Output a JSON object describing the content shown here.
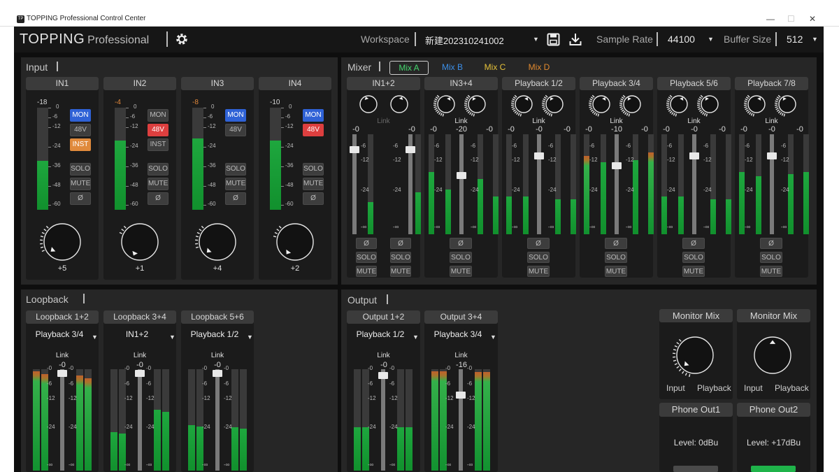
{
  "window": {
    "title": "TOPPING Professional Control Center",
    "icon": "topping-app-icon",
    "minimize": "—",
    "maximize": "☐",
    "close": "✕"
  },
  "topbar": {
    "brand": "TOPPING",
    "brand_sub": "Professional",
    "workspace_label": "Workspace",
    "workspace_value": "新建202310241002",
    "sample_rate_label": "Sample Rate",
    "sample_rate_value": "44100",
    "buffer_size_label": "Buffer Size",
    "buffer_size_value": "512"
  },
  "input": {
    "label": "Input",
    "channels": [
      {
        "name": "IN1",
        "peak": "-18",
        "knob": "+5",
        "mon": "MON",
        "v48": "48V",
        "inst": "INST",
        "solo": "SOLO",
        "mute": "MUTE",
        "phase": "Ø",
        "level": 0.48
      },
      {
        "name": "IN2",
        "peak": "-4",
        "knob": "+1",
        "mon": "MON",
        "v48": "48V",
        "inst": "INST",
        "solo": "SOLO",
        "mute": "MUTE",
        "phase": "Ø",
        "level": 0.68
      },
      {
        "name": "IN3",
        "peak": "-8",
        "knob": "+4",
        "mon": "MON",
        "v48": "48V",
        "solo": "SOLO",
        "mute": "MUTE",
        "phase": "Ø",
        "level": 0.7
      },
      {
        "name": "IN4",
        "peak": "-10",
        "knob": "+2",
        "mon": "MON",
        "v48": "48V",
        "solo": "SOLO",
        "mute": "MUTE",
        "phase": "Ø",
        "level": 0.68
      }
    ],
    "scale": [
      "0",
      "-6",
      "-12",
      "-24",
      "-36",
      "-48",
      "-60"
    ]
  },
  "mixer": {
    "label": "Mixer",
    "tabs": [
      "Mix A",
      "Mix B",
      "Mix C",
      "Mix D"
    ],
    "tab_colors": [
      "#45d66e",
      "#3c8fe8",
      "#e6c23a",
      "#e0892f"
    ],
    "channels": [
      {
        "name": "IN1+2",
        "link": "Link",
        "left": "-0",
        "center": "",
        "right": "-0"
      },
      {
        "name": "IN3+4",
        "link": "Link",
        "left": "-0",
        "center": "-20",
        "right": "-0"
      },
      {
        "name": "Playback 1/2",
        "link": "Link",
        "left": "-0",
        "center": "-0",
        "right": "-0"
      },
      {
        "name": "Playback 3/4",
        "link": "Link",
        "left": "-0",
        "center": "-10",
        "right": "-0"
      },
      {
        "name": "Playback 5/6",
        "link": "Link",
        "left": "-0",
        "center": "-0",
        "right": "-0"
      },
      {
        "name": "Playback 7/8",
        "link": "Link",
        "left": "-0",
        "center": "-0",
        "right": "-0"
      }
    ],
    "scale": [
      "-6",
      "-12",
      "-24",
      "-∞"
    ],
    "phase": "Ø",
    "solo": "SOLO",
    "mute": "MUTE"
  },
  "loopback": {
    "label": "Loopback",
    "channels": [
      {
        "name": "Loopback 1+2",
        "source": "Playback 3/4",
        "link": "Link",
        "fader": "-0"
      },
      {
        "name": "Loopback 3+4",
        "source": "IN1+2",
        "link": "Link",
        "fader": "-0"
      },
      {
        "name": "Loopback 5+6",
        "source": "Playback 1/2",
        "link": "Link",
        "fader": "-0"
      }
    ],
    "scale": [
      "-0",
      "-6",
      "-12",
      "-24",
      "-∞"
    ]
  },
  "output": {
    "label": "Output",
    "channels": [
      {
        "name": "Output 1+2",
        "source": "Playback 1/2",
        "link": "Link",
        "fader": "-0"
      },
      {
        "name": "Output 3+4",
        "source": "Playback 3/4",
        "link": "Link",
        "fader": "-16"
      }
    ],
    "scale": [
      "-0",
      "-6",
      "-12",
      "-24",
      "-∞"
    ],
    "monitor": [
      {
        "title": "Monitor Mix",
        "input": "Input",
        "playback": "Playback"
      },
      {
        "title": "Monitor Mix",
        "input": "Input",
        "playback": "Playback"
      }
    ],
    "phones": [
      {
        "title": "Phone Out1",
        "level": "Level:  0dBu"
      },
      {
        "title": "Phone Out2",
        "level": "Level: +17dBu"
      }
    ]
  }
}
